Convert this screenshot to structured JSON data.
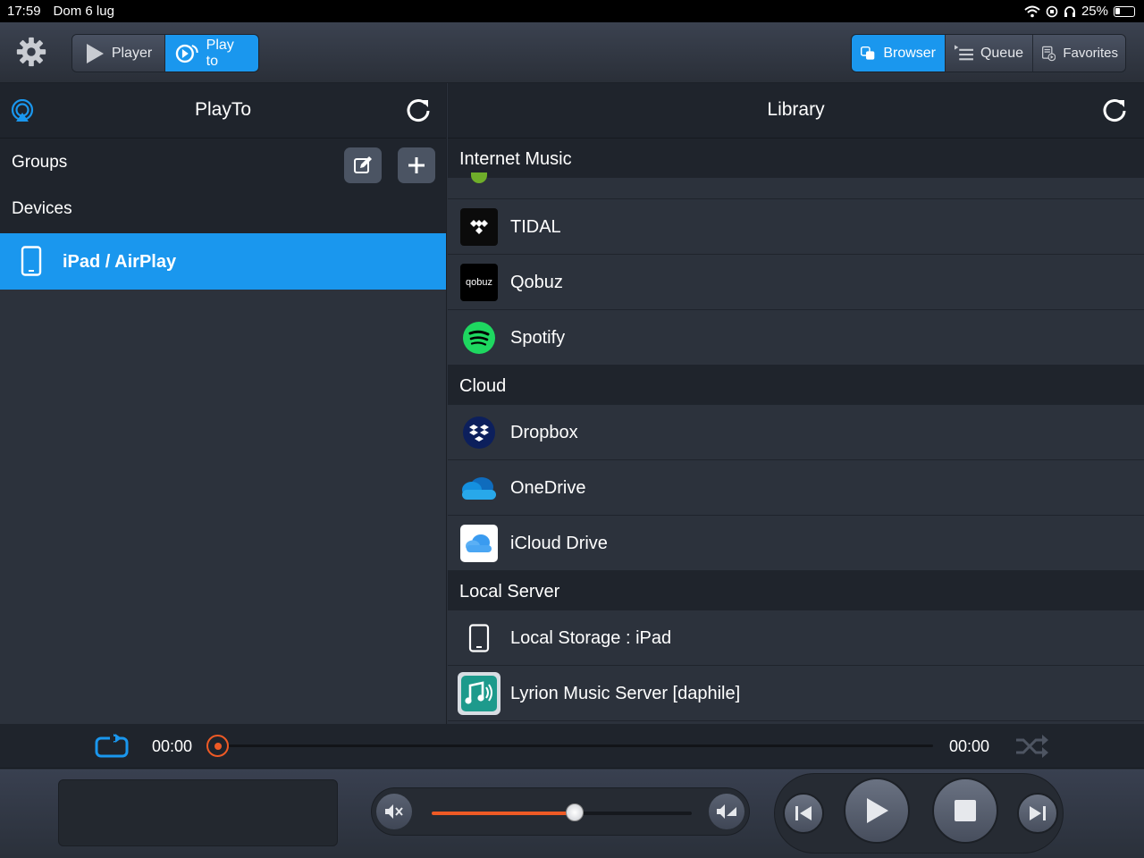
{
  "status": {
    "time": "17:59",
    "date": "Dom 6 lug",
    "battery": "25%",
    "battery_level": 0.25,
    "icons": [
      "wifi-icon",
      "orientation-lock-icon",
      "headphones-icon",
      "battery-icon"
    ]
  },
  "toolbar": {
    "player_label": "Player",
    "playto_label": "Play to",
    "browser_label": "Browser",
    "queue_label": "Queue",
    "favorites_label": "Favorites",
    "accent": "#1a97ee"
  },
  "left": {
    "title": "PlayTo",
    "groups_label": "Groups",
    "devices_label": "Devices",
    "devices": [
      {
        "label": "iPad / AirPlay",
        "selected": true
      }
    ]
  },
  "right": {
    "title": "Library",
    "sections": [
      {
        "label": "Internet Music",
        "items": [
          {
            "label": "TIDAL",
            "icon": "tidal-icon"
          },
          {
            "label": "Qobuz",
            "icon": "qobuz-icon",
            "icon_text": "qobuz"
          },
          {
            "label": "Spotify",
            "icon": "spotify-icon"
          }
        ]
      },
      {
        "label": "Cloud",
        "items": [
          {
            "label": "Dropbox",
            "icon": "dropbox-icon"
          },
          {
            "label": "OneDrive",
            "icon": "onedrive-icon"
          },
          {
            "label": "iCloud Drive",
            "icon": "icloud-icon"
          }
        ]
      },
      {
        "label": "Local Server",
        "items": [
          {
            "label": "Local Storage : iPad",
            "icon": "tablet-icon"
          },
          {
            "label": "Lyrion Music Server [daphile]",
            "icon": "music-server-icon"
          }
        ]
      }
    ]
  },
  "playback": {
    "elapsed": "00:00",
    "duration": "00:00",
    "progress": 0,
    "volume": 0.55,
    "progress_color": "#ee5a25"
  }
}
